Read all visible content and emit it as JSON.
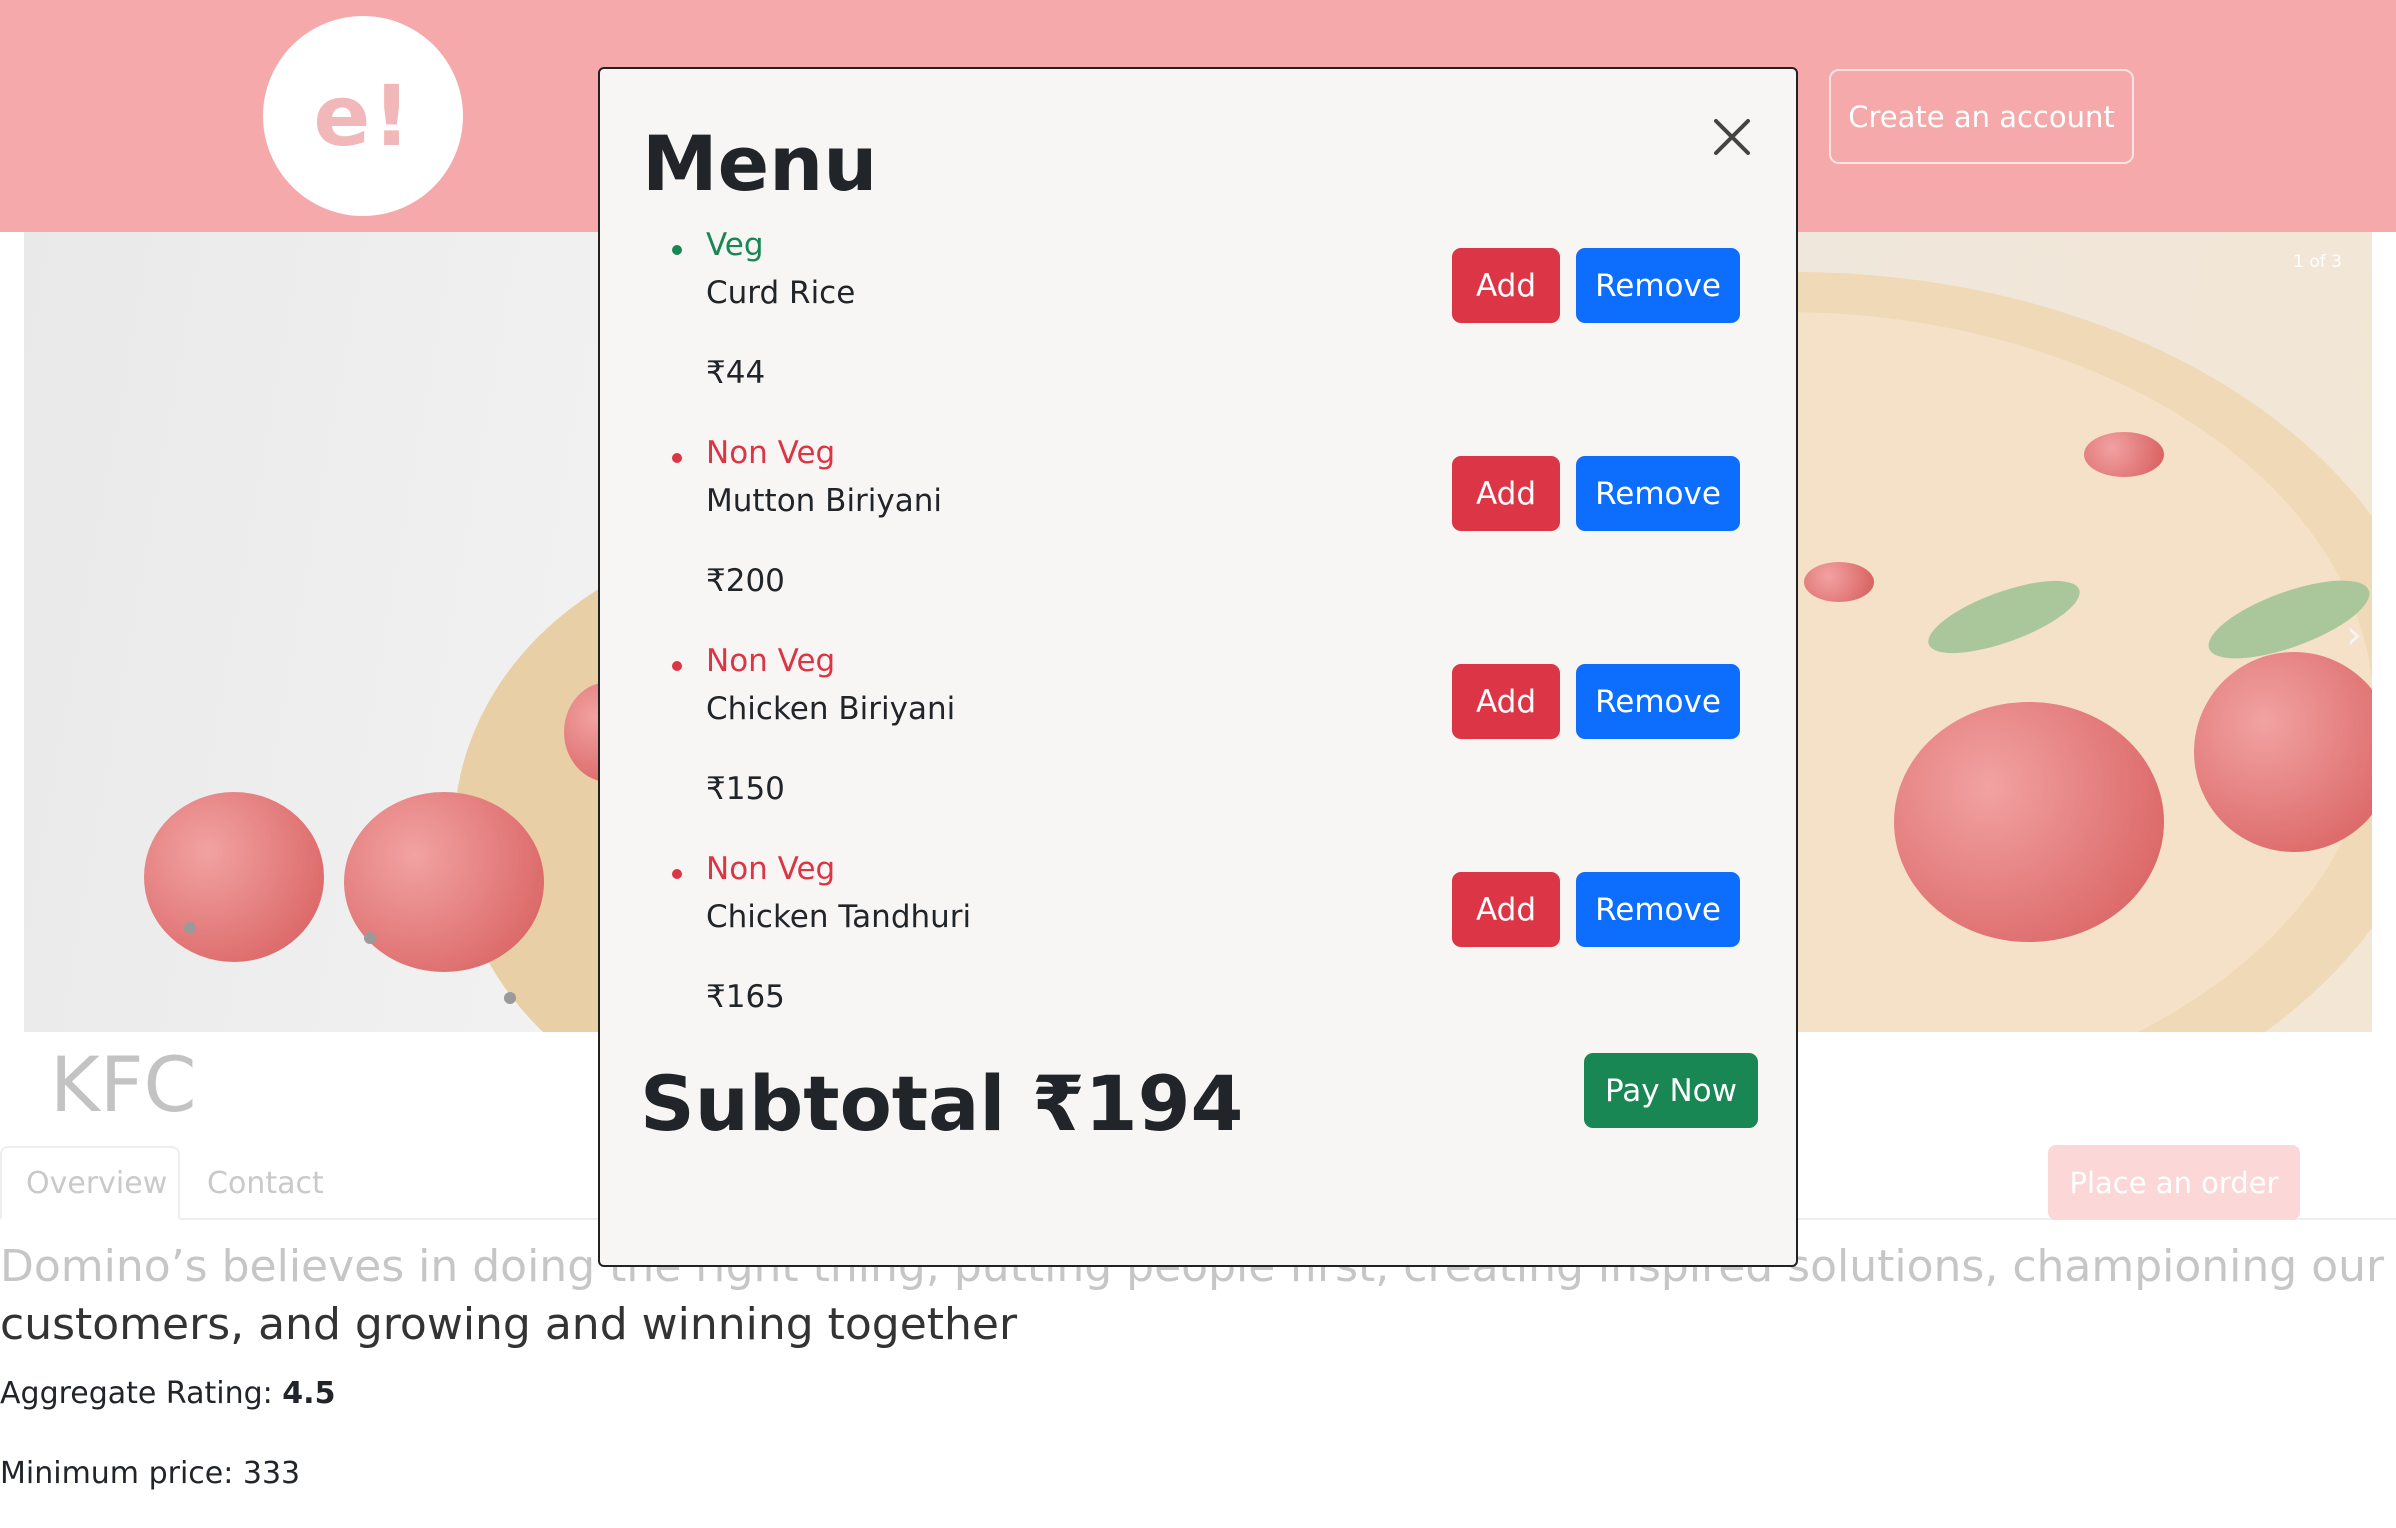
{
  "header": {
    "logo_text": "e!",
    "create_account_label": "Create an account"
  },
  "carousel": {
    "counter": "1 of 3",
    "slide_count": 3,
    "active_index": 0
  },
  "restaurant": {
    "name": "KFC",
    "tabs": [
      {
        "label": "Overview",
        "active": true
      },
      {
        "label": "Contact",
        "active": false
      }
    ],
    "place_order_label": "Place an order",
    "description_faded": "Domino’s believes in doing the right thing, putting people first, creating inspired solutions, championing our",
    "description_dark": "customers, and growing and winning together",
    "rating_label": "Aggregate Rating: ",
    "rating_value": "4.5",
    "min_price_label": "Minimum price: 333"
  },
  "modal": {
    "title": "Menu",
    "items": [
      {
        "type": "Veg",
        "name": "Curd Rice",
        "price": "₹44"
      },
      {
        "type": "Non Veg",
        "name": "Mutton Biriyani",
        "price": "₹200"
      },
      {
        "type": "Non Veg",
        "name": "Chicken Biriyani",
        "price": "₹150"
      },
      {
        "type": "Non Veg",
        "name": "Chicken Tandhuri",
        "price": "₹165"
      }
    ],
    "add_label": "Add",
    "remove_label": "Remove",
    "subtotal": "Subtotal ₹194",
    "pay_label": "Pay Now"
  },
  "colors": {
    "header_bg": "#f5a9aa",
    "veg": "#198754",
    "non_veg": "#dc3545",
    "add_button": "#dc3545",
    "remove_button": "#0d6efd",
    "pay_button": "#198754",
    "modal_bg": "#f7f6f4"
  },
  "icons": {
    "close": "close-icon",
    "carousel_next": "chevron-right-icon"
  }
}
